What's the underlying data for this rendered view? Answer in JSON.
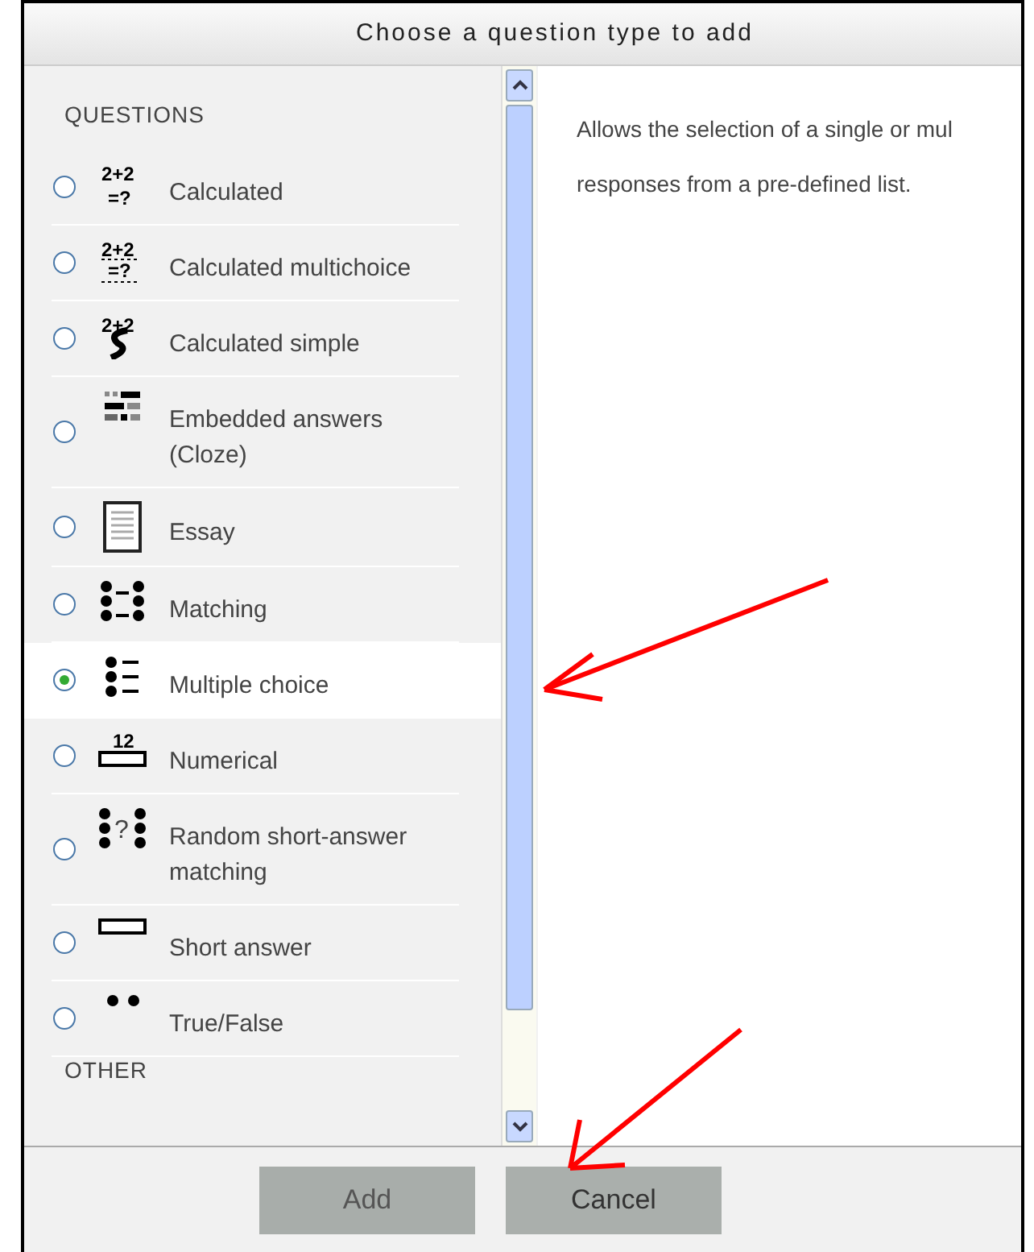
{
  "dialog": {
    "title": "Choose a question type to add"
  },
  "sections": [
    {
      "heading": "QUESTIONS",
      "items": [
        {
          "label": "Calculated",
          "kind": "calculated",
          "icon_text": [
            "2+2",
            "=?"
          ],
          "selected": false
        },
        {
          "label": "Calculated multichoice",
          "kind": "calcmulti",
          "icon_text": [
            "2+2",
            "=?"
          ],
          "selected": false
        },
        {
          "label": "Calculated simple",
          "kind": "calcsimple",
          "icon_text": [
            "2+2"
          ],
          "selected": false
        },
        {
          "label": "Embedded answers (Cloze)",
          "kind": "cloze",
          "selected": false
        },
        {
          "label": "Essay",
          "kind": "essay",
          "selected": false
        },
        {
          "label": "Matching",
          "kind": "matching",
          "selected": false
        },
        {
          "label": "Multiple choice",
          "kind": "multichoice",
          "selected": true
        },
        {
          "label": "Numerical",
          "kind": "numerical",
          "icon_text": [
            "12"
          ],
          "selected": false
        },
        {
          "label": "Random short-answer matching",
          "kind": "randommatch",
          "icon_text": [
            "?"
          ],
          "selected": false
        },
        {
          "label": "Short answer",
          "kind": "shortanswer",
          "selected": false
        },
        {
          "label": "True/False",
          "kind": "truefalse",
          "selected": false
        }
      ]
    },
    {
      "heading": "OTHER"
    }
  ],
  "description_lines": [
    "Allows the selection of a single or mul",
    "responses from a pre-defined list."
  ],
  "buttons": [
    {
      "label": "Add",
      "disabled": true
    },
    {
      "label": "Cancel",
      "disabled": false
    }
  ]
}
